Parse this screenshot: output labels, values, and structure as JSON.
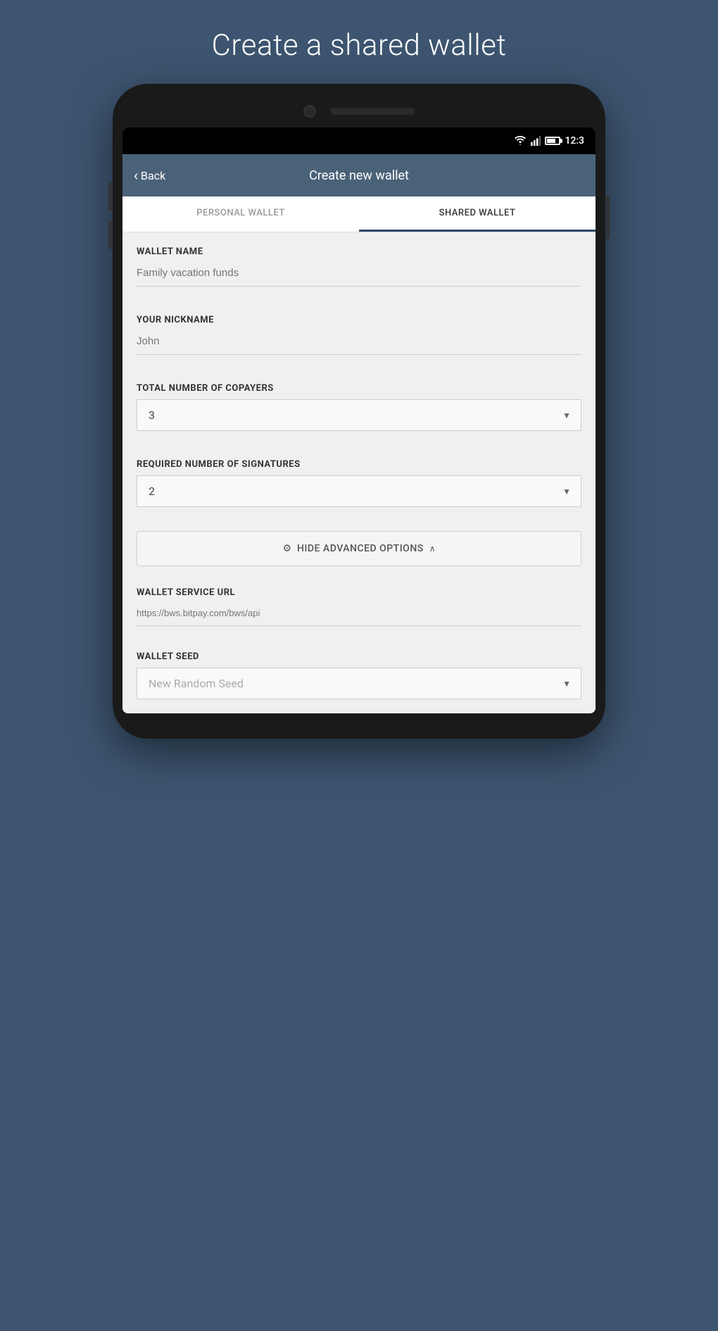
{
  "page": {
    "title": "Create a shared wallet"
  },
  "status_bar": {
    "time": "12:3"
  },
  "header": {
    "back_label": "Back",
    "title": "Create new wallet"
  },
  "tabs": [
    {
      "id": "personal",
      "label": "PERSONAL WALLET",
      "active": false
    },
    {
      "id": "shared",
      "label": "SHARED WALLET",
      "active": true
    }
  ],
  "form": {
    "wallet_name": {
      "label": "WALLET NAME",
      "placeholder": "Family vacation funds",
      "value": ""
    },
    "nickname": {
      "label": "YOUR NICKNAME",
      "placeholder": "John",
      "value": ""
    },
    "total_copayers": {
      "label": "TOTAL NUMBER OF COPAYERS",
      "value": "3"
    },
    "required_signatures": {
      "label": "REQUIRED NUMBER OF SIGNATURES",
      "value": "2"
    },
    "advanced_options_button": {
      "gear_icon": "⚙",
      "label": "HIDE ADVANCED OPTIONS",
      "caret": "∧"
    },
    "wallet_service_url": {
      "label": "WALLET SERVICE URL",
      "placeholder": "https://bws.bitpay.com/bws/api",
      "value": ""
    },
    "wallet_seed": {
      "label": "WALLET SEED",
      "value": "New Random Seed"
    }
  }
}
